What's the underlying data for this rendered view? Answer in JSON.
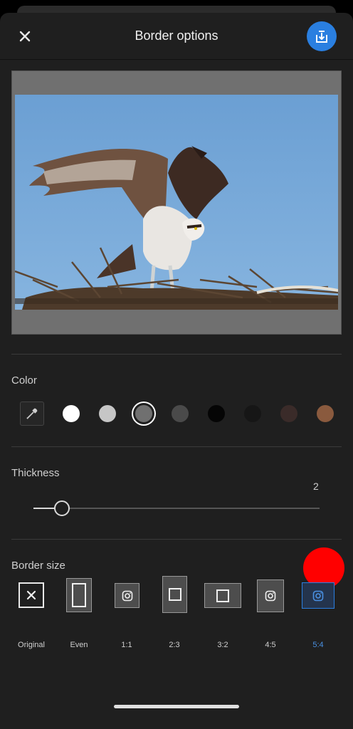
{
  "header": {
    "title": "Border options",
    "close_icon": "close-icon",
    "export_icon": "export-icon",
    "accent": "#2a7fe0"
  },
  "preview": {
    "border_color": "#707070"
  },
  "color": {
    "label": "Color",
    "eyedropper_icon": "eyedropper-icon",
    "swatches": [
      {
        "hex": "#ffffff",
        "selected": false
      },
      {
        "hex": "#c6c6c6",
        "selected": false
      },
      {
        "hex": "#707070",
        "selected": true
      },
      {
        "hex": "#4a4a4a",
        "selected": false
      },
      {
        "hex": "#050505",
        "selected": false
      },
      {
        "hex": "#161616",
        "selected": false
      },
      {
        "hex": "#3a2b29",
        "selected": false
      },
      {
        "hex": "#8a5a3e",
        "selected": false
      }
    ]
  },
  "thickness": {
    "label": "Thickness",
    "value": "2",
    "fraction": 0.1
  },
  "border_size": {
    "label": "Border size",
    "options": [
      {
        "label": "Original",
        "icon": "no-border-icon",
        "selected": false
      },
      {
        "label": "Even",
        "icon": "even-border-icon",
        "selected": false
      },
      {
        "label": "1:1",
        "icon": "instagram-icon",
        "selected": false
      },
      {
        "label": "2:3",
        "icon": "square-icon",
        "selected": false
      },
      {
        "label": "3:2",
        "icon": "square-icon",
        "selected": false
      },
      {
        "label": "4:5",
        "icon": "instagram-icon",
        "selected": false
      },
      {
        "label": "5:4",
        "icon": "instagram-icon",
        "selected": true
      }
    ],
    "selected_color": "#2a7fe0"
  },
  "overlay": {
    "marker_color": "#ff0000"
  }
}
